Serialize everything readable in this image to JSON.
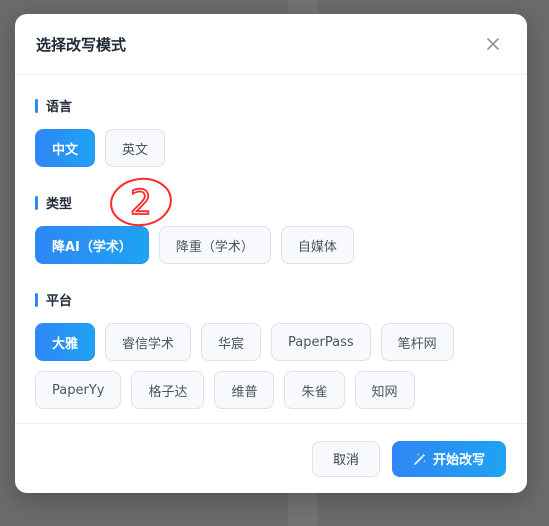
{
  "modal": {
    "title": "选择改写模式",
    "close_icon": "close-icon"
  },
  "sections": {
    "language": {
      "label": "语言",
      "options": [
        "中文",
        "英文"
      ],
      "selected": "中文"
    },
    "type": {
      "label": "类型",
      "options": [
        "降AI（学术）",
        "降重（学术）",
        "自媒体"
      ],
      "selected": "降AI（学术）"
    },
    "platform": {
      "label": "平台",
      "options": [
        "大雅",
        "睿信学术",
        "华宸",
        "PaperPass",
        "笔杆网",
        "PaperYy",
        "格子达",
        "维普",
        "朱雀",
        "知网"
      ],
      "selected": "大雅"
    }
  },
  "annotation_mark": "2",
  "footer": {
    "cancel_label": "取消",
    "confirm_label": "开始改写",
    "confirm_icon": "magic-wand-icon"
  },
  "colors": {
    "accent": "#2f86f6",
    "accent_end": "#1ea3f2",
    "annotation": "#ff2a2a"
  }
}
